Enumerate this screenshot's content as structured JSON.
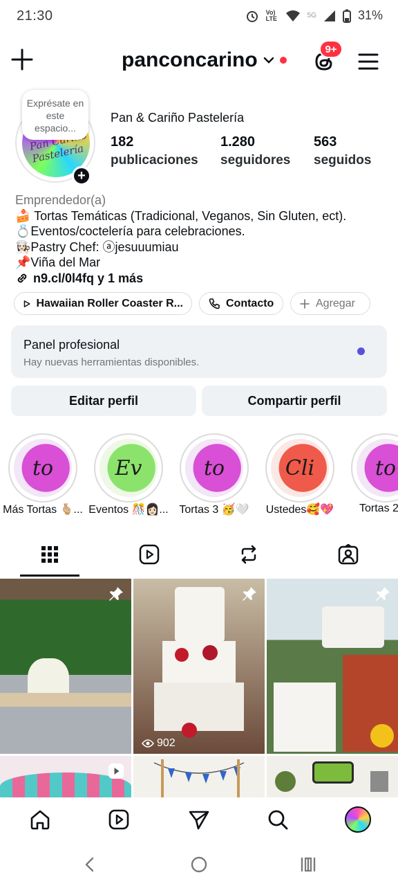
{
  "status_bar": {
    "time": "21:30",
    "battery": "31%",
    "network_label": "5G",
    "volte_label": "Vo) LTE"
  },
  "header": {
    "username": "panconcarino",
    "badge": "9+"
  },
  "profile": {
    "note": "Exprésate en este espacio...",
    "avatar_text": "Pan Cariño Pastelería",
    "display_name": "Pan & Cariño Pastelería",
    "stats": [
      {
        "value": "182",
        "label": "publicaciones"
      },
      {
        "value": "1.280",
        "label": "seguidores"
      },
      {
        "value": "563",
        "label": "seguidos"
      }
    ],
    "category": "Emprendedor(a)",
    "bio": [
      "🍰 Tortas Temáticas (Tradicional, Veganos, Sin Gluten, ect).",
      "💍Eventos/coctelería para celebraciones.",
      "👩🏻‍🍳Pastry Chef: ⓐjesuuumiau",
      "📌Viña del Mar"
    ],
    "link": "n9.cl/0l4fq y 1 más"
  },
  "pills": {
    "music": "Hawaiian Roller Coaster R...",
    "contact": "Contacto",
    "add": "Agregar"
  },
  "panel": {
    "title": "Panel profesional",
    "subtitle": "Hay nuevas herramientas disponibles."
  },
  "actions": {
    "edit": "Editar perfil",
    "share": "Compartir perfil"
  },
  "highlights": [
    {
      "label": "Más Tortas 🫰🏼...",
      "letters": "to",
      "color": "#d94fd6"
    },
    {
      "label": "Eventos 🎊👩🏻‍...",
      "letters": "Ev",
      "color": "#8be36b"
    },
    {
      "label": "Tortas 3 🥳🤍",
      "letters": "to",
      "color": "#d94fd6"
    },
    {
      "label": "Ustedes🥰💖",
      "letters": "Cli",
      "color": "#ef5a4a"
    },
    {
      "label": "Tortas 2",
      "letters": "to",
      "color": "#d94fd6"
    }
  ],
  "grid": {
    "views_2": "902"
  },
  "icons": {
    "create": "plus-icon",
    "threads": "threads-icon",
    "menu": "hamburger-icon",
    "tab_grid": "grid-icon",
    "tab_reels": "reels-icon",
    "tab_reposts": "repost-icon",
    "tab_tagged": "tagged-icon",
    "nav_home": "home-icon",
    "nav_reels": "reels-icon",
    "nav_send": "send-icon",
    "nav_search": "search-icon"
  }
}
